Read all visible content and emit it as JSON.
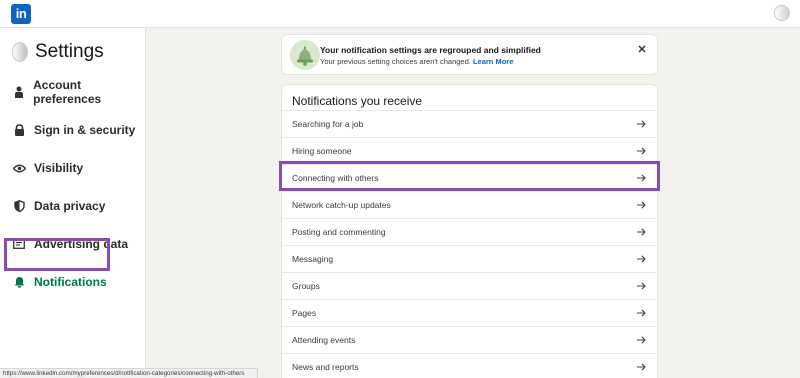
{
  "app": {
    "logo_text": "in",
    "brand_color": "#0a66c2"
  },
  "sidebar": {
    "title": "Settings",
    "active_color": "#01754f",
    "highlight_color": "#8a4bb3",
    "items": [
      {
        "label": "Account preferences",
        "icon": "person-icon"
      },
      {
        "label": "Sign in & security",
        "icon": "lock-icon"
      },
      {
        "label": "Visibility",
        "icon": "eye-icon"
      },
      {
        "label": "Data privacy",
        "icon": "shield-icon"
      },
      {
        "label": "Advertising data",
        "icon": "ad-card-icon"
      },
      {
        "label": "Notifications",
        "icon": "bell-icon",
        "active": true
      }
    ]
  },
  "banner": {
    "title": "Your notification settings are regrouped and simplified",
    "subtitle": "Your previous setting choices aren't changed.",
    "link": "Learn More",
    "close": "✕"
  },
  "notifications": {
    "heading": "Notifications you receive",
    "items": [
      "Searching for a job",
      "Hiring someone",
      "Connecting with others",
      "Network catch-up updates",
      "Posting and commenting",
      "Messaging",
      "Groups",
      "Pages",
      "Attending events",
      "News and reports"
    ],
    "highlighted": "Connecting with others"
  },
  "status": {
    "url": "https://www.linkedin.com/mypreferences/d/notification-categories/connecting-with-others"
  }
}
